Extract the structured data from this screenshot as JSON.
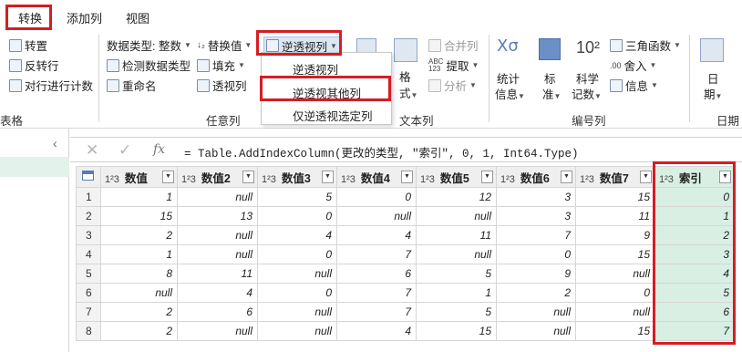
{
  "tabs": [
    "转换",
    "添加列",
    "视图"
  ],
  "ribbon": {
    "table_group": {
      "items": [
        "转置",
        "反转行",
        "对行进行计数"
      ],
      "label_fragment": "表格"
    },
    "any_column_group": {
      "data_type": "数据类型: 整数",
      "detect_type": "检测数据类型",
      "rename": "重命名",
      "replace_values": "替换值",
      "fill": "填充",
      "pivot": "透视列",
      "unpivot": "逆透视列",
      "label": "任意列"
    },
    "text_group": {
      "format": "格",
      "format_sub": "式",
      "merge": "合并列",
      "extract": "提取",
      "parse": "分析",
      "label": "文本列"
    },
    "number_group": {
      "statistics": "统计",
      "statistics_sub": "信息",
      "standard": "标",
      "standard_sub": "准",
      "scientific": "科学",
      "scientific_sub": "记数",
      "trig": "三角函数",
      "rounding": "舍入",
      "info": "信息",
      "label": "编号列"
    },
    "date_group": {
      "date": "日",
      "date_sub": "期",
      "label": "日期"
    }
  },
  "unpivot_menu": [
    "逆透视列",
    "逆透视其他列",
    "仅逆透视选定列"
  ],
  "formula_bar": {
    "fx": "fx",
    "formula": "= Table.AddIndexColumn(更改的类型, \"索引\", 0, 1, Int64.Type)"
  },
  "table": {
    "type_badge": "1²3",
    "columns": [
      "数值",
      "数值2",
      "数值3",
      "数值4",
      "数值5",
      "数值6",
      "数值7",
      "索引"
    ],
    "rows": [
      [
        "1",
        "null",
        "5",
        "0",
        "12",
        "3",
        "15",
        "0"
      ],
      [
        "15",
        "13",
        "0",
        "null",
        "null",
        "3",
        "11",
        "1"
      ],
      [
        "2",
        "null",
        "4",
        "4",
        "11",
        "7",
        "9",
        "2"
      ],
      [
        "1",
        "null",
        "0",
        "7",
        "null",
        "0",
        "15",
        "3"
      ],
      [
        "8",
        "11",
        "null",
        "6",
        "5",
        "9",
        "null",
        "4"
      ],
      [
        "null",
        "4",
        "0",
        "7",
        "1",
        "2",
        "0",
        "5"
      ],
      [
        "2",
        "6",
        "null",
        "7",
        "5",
        "null",
        "null",
        "6"
      ],
      [
        "2",
        "null",
        "null",
        "4",
        "15",
        "null",
        "15",
        "7"
      ]
    ]
  }
}
